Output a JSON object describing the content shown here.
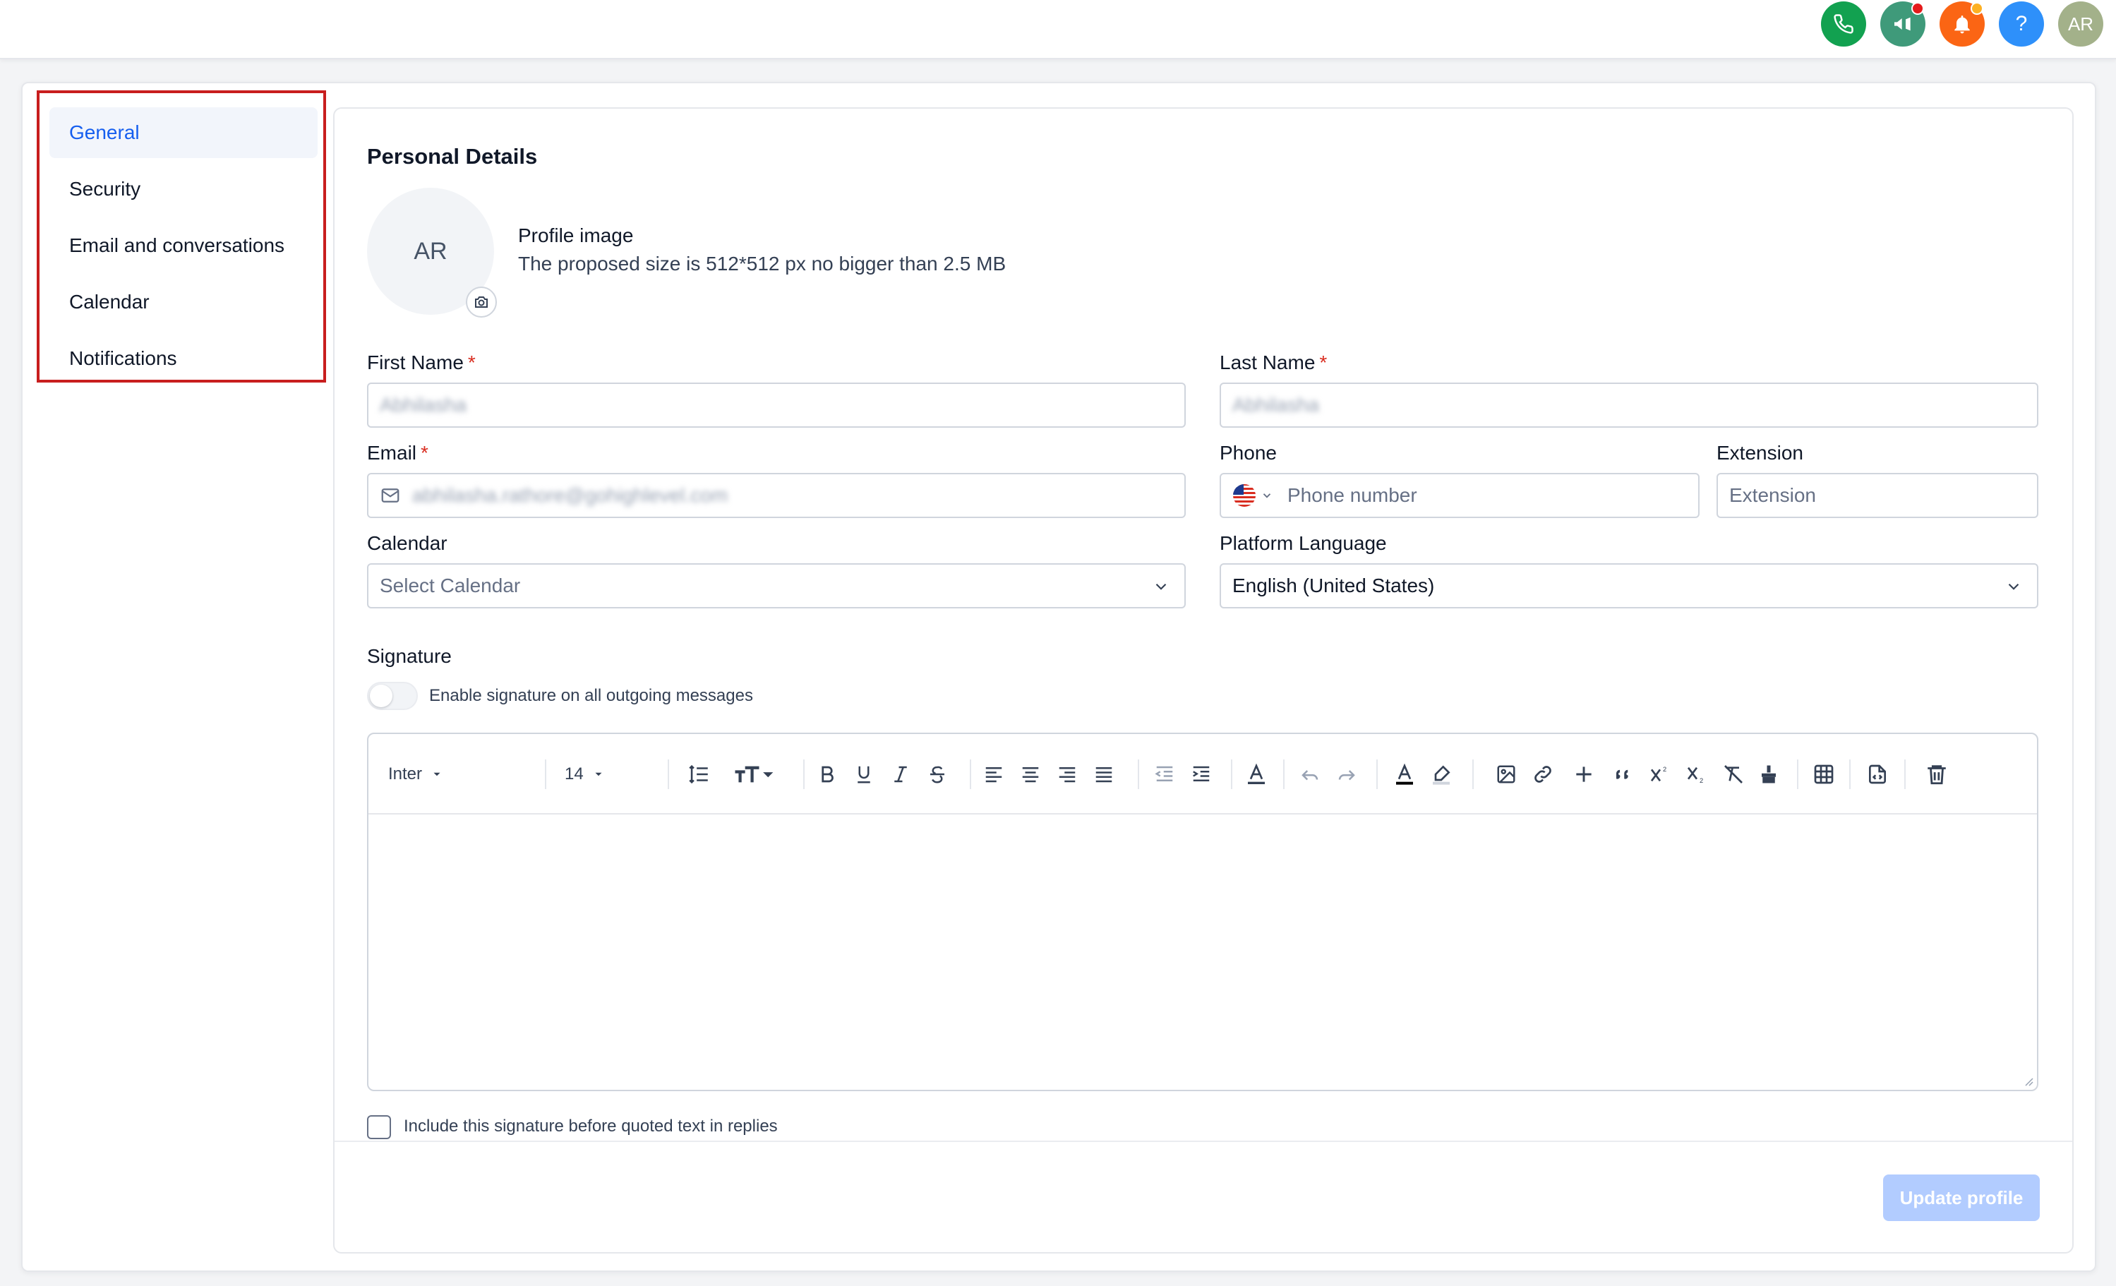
{
  "header": {
    "icons": [
      {
        "name": "phone-icon",
        "color": "#12a150"
      },
      {
        "name": "megaphone-icon",
        "color": "#3f9a7a",
        "badge_color": "#e41b1b"
      },
      {
        "name": "bell-icon",
        "color": "#fb6514",
        "badge_color": "#fdb022"
      },
      {
        "name": "help-icon",
        "color": "#2e90fa",
        "glyph": "?"
      }
    ],
    "user_initials": "AR"
  },
  "sidebar": {
    "items": [
      {
        "label": "General",
        "active": true
      },
      {
        "label": "Security",
        "active": false
      },
      {
        "label": "Email and conversations",
        "active": false
      },
      {
        "label": "Calendar",
        "active": false
      },
      {
        "label": "Notifications",
        "active": false
      }
    ]
  },
  "personal_details": {
    "title": "Personal Details",
    "avatar_initials": "AR",
    "profile_image_label": "Profile image",
    "profile_image_hint": "The proposed size is 512*512 px no bigger than 2.5 MB",
    "first_name": {
      "label": "First Name",
      "required_mark": "*",
      "value": "Abhilasha"
    },
    "last_name": {
      "label": "Last Name",
      "required_mark": "*",
      "value": "Abhilasha"
    },
    "email": {
      "label": "Email",
      "required_mark": "*",
      "value": "abhilasha.rathore@gohighlevel.com"
    },
    "phone": {
      "label": "Phone",
      "placeholder": "Phone number",
      "country_flag": "US"
    },
    "extension": {
      "label": "Extension",
      "placeholder": "Extension"
    },
    "calendar": {
      "label": "Calendar",
      "placeholder": "Select Calendar"
    },
    "platform_language": {
      "label": "Platform Language",
      "value": "English (United States)"
    }
  },
  "signature": {
    "title": "Signature",
    "toggle_label": "Enable signature on all outgoing messages",
    "toggle_on": false,
    "editor": {
      "font_family": "Inter",
      "font_size": "14",
      "tools": [
        "line-height",
        "text-size",
        "bold",
        "underline",
        "italic",
        "strikethrough",
        "align-left",
        "align-center",
        "align-right",
        "align-justify",
        "outdent",
        "indent",
        "text-color",
        "undo",
        "redo",
        "font-color",
        "highlight",
        "image",
        "link",
        "add",
        "quote",
        "superscript",
        "subscript",
        "clear-format",
        "paint",
        "table",
        "code-file",
        "delete"
      ]
    },
    "include_before_quoted_label": "Include this signature before quoted text in replies",
    "include_before_quoted_checked": false
  },
  "actions": {
    "update_label": "Update profile",
    "update_color": "#b2ccff"
  }
}
